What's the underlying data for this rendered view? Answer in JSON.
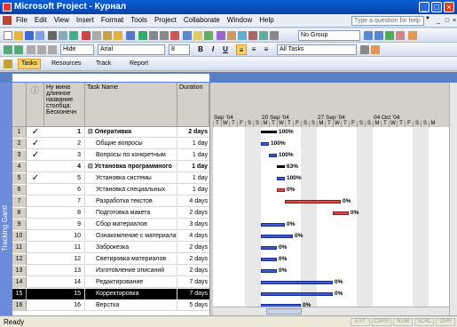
{
  "window": {
    "title": "Microsoft Project - Курнал"
  },
  "menu": {
    "items": [
      "File",
      "Edit",
      "View",
      "Insert",
      "Format",
      "Tools",
      "Project",
      "Collaborate",
      "Window",
      "Help"
    ],
    "help_placeholder": "Type a question for help"
  },
  "toolbar": {
    "group_value": "No Group",
    "font_value": "Arial",
    "size_value": "8",
    "bold": "B",
    "italic": "I",
    "underline": "U",
    "filter_value": "All Tasks",
    "hide_label": "Hide",
    "tabs": [
      "Tasks",
      "Resources",
      "Track",
      "Report"
    ]
  },
  "view_label": "Tracking Gantt",
  "table": {
    "headers": {
      "indicators": "ⓘ",
      "number": "Ну мина длинное название столбца: Бесконечн",
      "task": "Task Name",
      "duration": "Duration"
    },
    "rows": [
      {
        "id": "1",
        "check": "✓",
        "num": "1",
        "name": "⊟ Оперативка",
        "dur": "2 days",
        "summary": true
      },
      {
        "id": "2",
        "check": "✓",
        "num": "2",
        "name": "Общие вопросы",
        "dur": "1 day",
        "summary": false
      },
      {
        "id": "3",
        "check": "✓",
        "num": "3",
        "name": "Вопросы по конкретным",
        "dur": "1 day",
        "summary": false
      },
      {
        "id": "4",
        "check": "",
        "num": "4",
        "name": "⊟ Установка программного",
        "dur": "1 day",
        "summary": true
      },
      {
        "id": "5",
        "check": "✓",
        "num": "5",
        "name": "Установка системы",
        "dur": "1 day",
        "summary": false
      },
      {
        "id": "6",
        "check": "",
        "num": "6",
        "name": "Установка специальных",
        "dur": "1 day",
        "summary": false
      },
      {
        "id": "7",
        "check": "",
        "num": "7",
        "name": "Разработка текстов",
        "dur": "4 days",
        "summary": false
      },
      {
        "id": "8",
        "check": "",
        "num": "8",
        "name": "Подготовка макета",
        "dur": "2 days",
        "summary": false
      },
      {
        "id": "9",
        "check": "",
        "num": "9",
        "name": "Сбор материалов",
        "dur": "3 days",
        "summary": false
      },
      {
        "id": "10",
        "check": "",
        "num": "10",
        "name": "Ознакомление с материалами",
        "dur": "4 days",
        "summary": false
      },
      {
        "id": "11",
        "check": "",
        "num": "11",
        "name": "Заброкезка",
        "dur": "2 days",
        "summary": false
      },
      {
        "id": "12",
        "check": "",
        "num": "12",
        "name": "Светировка материалов",
        "dur": "2 days",
        "summary": false
      },
      {
        "id": "13",
        "check": "",
        "num": "13",
        "name": "Изготовление описаний",
        "dur": "2 days",
        "summary": false
      },
      {
        "id": "14",
        "check": "",
        "num": "14",
        "name": "Редактирование",
        "dur": "7 days",
        "summary": false
      },
      {
        "id": "15",
        "check": "",
        "num": "15",
        "name": "Корректировка",
        "dur": "7 days",
        "summary": false,
        "selected": true
      },
      {
        "id": "16",
        "check": "",
        "num": "16",
        "name": "Верстка",
        "dur": "5 days",
        "summary": false
      }
    ]
  },
  "timescale": {
    "weeks": [
      "Sep '04",
      "20 Sep '04",
      "27 Sep '04",
      "04 Oct '04"
    ],
    "days": [
      "T",
      "W",
      "T",
      "F",
      "S",
      "S",
      "M",
      "T",
      "W",
      "T",
      "F",
      "S",
      "S",
      "M",
      "T",
      "W",
      "T",
      "F",
      "S",
      "S",
      "M",
      "T",
      "W",
      "T",
      "F",
      "S",
      "S",
      "M"
    ]
  },
  "gantt": {
    "bars": [
      {
        "row": 0,
        "start": 6,
        "len": 2,
        "color": "summary",
        "pct": "100%"
      },
      {
        "row": 1,
        "start": 6,
        "len": 1,
        "color": "blue",
        "pct": "100%"
      },
      {
        "row": 2,
        "start": 7,
        "len": 1,
        "color": "blue",
        "pct": "100%"
      },
      {
        "row": 3,
        "start": 8,
        "len": 1,
        "color": "summary",
        "pct": "63%"
      },
      {
        "row": 4,
        "start": 8,
        "len": 1,
        "color": "blue",
        "pct": "100%"
      },
      {
        "row": 5,
        "start": 8,
        "len": 1,
        "color": "red",
        "pct": "0%"
      },
      {
        "row": 6,
        "start": 9,
        "len": 7,
        "color": "red",
        "pct": "0%"
      },
      {
        "row": 7,
        "start": 15,
        "len": 2,
        "color": "red",
        "pct": "0%"
      },
      {
        "row": 8,
        "start": 6,
        "len": 3,
        "color": "blue",
        "pct": "0%"
      },
      {
        "row": 9,
        "start": 6,
        "len": 4,
        "color": "blue",
        "pct": "0%"
      },
      {
        "row": 10,
        "start": 6,
        "len": 2,
        "color": "blue",
        "pct": "0%"
      },
      {
        "row": 11,
        "start": 6,
        "len": 2,
        "color": "blue",
        "pct": "0%"
      },
      {
        "row": 12,
        "start": 6,
        "len": 2,
        "color": "blue",
        "pct": "0%"
      },
      {
        "row": 13,
        "start": 6,
        "len": 9,
        "color": "blue",
        "pct": "0%"
      },
      {
        "row": 14,
        "start": 6,
        "len": 9,
        "color": "blue",
        "pct": "0%"
      },
      {
        "row": 15,
        "start": 6,
        "len": 5,
        "color": "blue",
        "pct": "0%"
      }
    ]
  },
  "status": {
    "ready": "Ready",
    "indicators": [
      "EXT",
      "CAPS",
      "NUM",
      "SCRL",
      "OVR"
    ]
  }
}
